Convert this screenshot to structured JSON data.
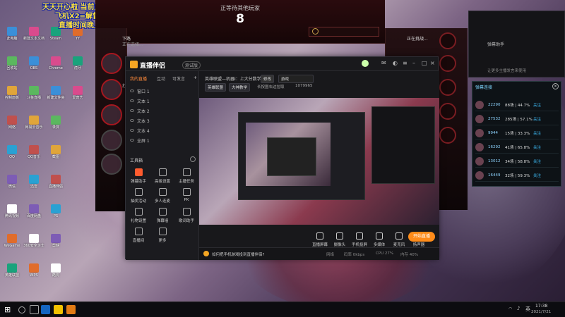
{
  "overlay": {
    "line1": "天天开心啦    当前直播段位炒饭大师",
    "line2": "飞机X2=解督 7级斗鱼粉丝牌群222343739",
    "line3": "直播时间晚上8-2  上号Q361191594"
  },
  "game": {
    "header": "正等待其他玩家",
    "count": "8",
    "player1": "下路",
    "player1_sub": "正在选择...",
    "player2_sub": "正在选择...",
    "player3": "打",
    "right_label": "正在挑战..."
  },
  "desktop_icons": [
    "此电脑",
    "回收站",
    "控制面板",
    "网络",
    "QQ",
    "微信",
    "腾讯视频",
    "WeGame",
    "英雄联盟",
    "新建文本文档",
    "OBS",
    "斗鱼直播",
    "网易云音乐",
    "QQ音乐",
    "迅雷",
    "百度网盘",
    "360安全卫士",
    "WPS",
    "Steam",
    "Chrome",
    "新建文件夹",
    "录屏",
    "截图",
    "直播伴侣",
    "PS",
    "剪映",
    "酷狗",
    "YY",
    "虎牙",
    "爱奇艺"
  ],
  "app": {
    "brand": "直播伴侣",
    "beta": "测试版",
    "tabs": [
      "我的直播",
      "互动",
      "可发言"
    ],
    "sources": [
      "窗口 1",
      "文本 1",
      "文本 2",
      "文本 3",
      "文本 4",
      "全屏 1"
    ],
    "tools_title": "工具箱",
    "tools": [
      "弹幕助手",
      "高级设置",
      "主播任务",
      "抽奖活动",
      "多人连麦",
      "PK",
      "礼物设置",
      "弹幕墙",
      "歌词助手",
      "直播间",
      "更多"
    ],
    "room_title": "英雄联盟—机器i：上大分数学",
    "room_tag": "修改",
    "category": "游戏",
    "chips": [
      "英雄联盟",
      "大神教学",
      "长按图右边拉取",
      "1079965"
    ],
    "bottom_tools": [
      "直播屏幕",
      "摄像头",
      "手机投屏",
      "多媒体",
      "麦克风",
      "扬声器"
    ],
    "start": "开始直播",
    "notice": "如何把手机游戏投到直播伴侣?",
    "status": [
      "网络",
      "码率 0kbps",
      "CPU 27%",
      "内存 40%"
    ]
  },
  "right_panel": {
    "title1": "弹幕助手",
    "sub1": "让更多主播发言来使用",
    "title2": "弹幕连接",
    "rows": [
      {
        "score": "22290",
        "record": "88场 | 44.7%",
        "link": "关注"
      },
      {
        "score": "27532",
        "record": "285场 | 57.1%",
        "link": "关注"
      },
      {
        "score": "9944",
        "record": "15场 | 33.3%",
        "link": "关注"
      },
      {
        "score": "16292",
        "record": "41场 | 65.8%",
        "link": "关注"
      },
      {
        "score": "13012",
        "record": "34场 | 58.8%",
        "link": "关注"
      },
      {
        "score": "16449",
        "record": "32场 | 59.3%",
        "link": "关注"
      }
    ]
  },
  "taskbar": {
    "time": "17:38",
    "date": "2021/7/21",
    "lang": "英"
  }
}
